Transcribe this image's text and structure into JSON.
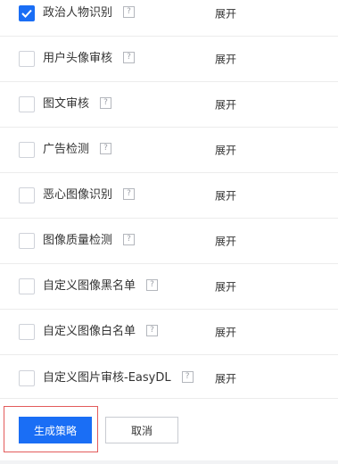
{
  "items": [
    {
      "label": "政治人物识别",
      "checked": true,
      "expand": "展开"
    },
    {
      "label": "用户头像审核",
      "checked": false,
      "expand": "展开"
    },
    {
      "label": "图文审核",
      "checked": false,
      "expand": "展开"
    },
    {
      "label": "广告检测",
      "checked": false,
      "expand": "展开"
    },
    {
      "label": "恶心图像识别",
      "checked": false,
      "expand": "展开"
    },
    {
      "label": "图像质量检测",
      "checked": false,
      "expand": "展开"
    },
    {
      "label": "自定义图像黑名单",
      "checked": false,
      "expand": "展开"
    },
    {
      "label": "自定义图像白名单",
      "checked": false,
      "expand": "展开"
    },
    {
      "label": "自定义图片审核-EasyDL",
      "checked": false,
      "expand": "展开"
    }
  ],
  "help_glyph": "?",
  "footer": {
    "generate_label": "生成策略",
    "cancel_label": "取消"
  },
  "colors": {
    "primary": "#1a6ef5",
    "highlight_border": "#e35b5b"
  }
}
